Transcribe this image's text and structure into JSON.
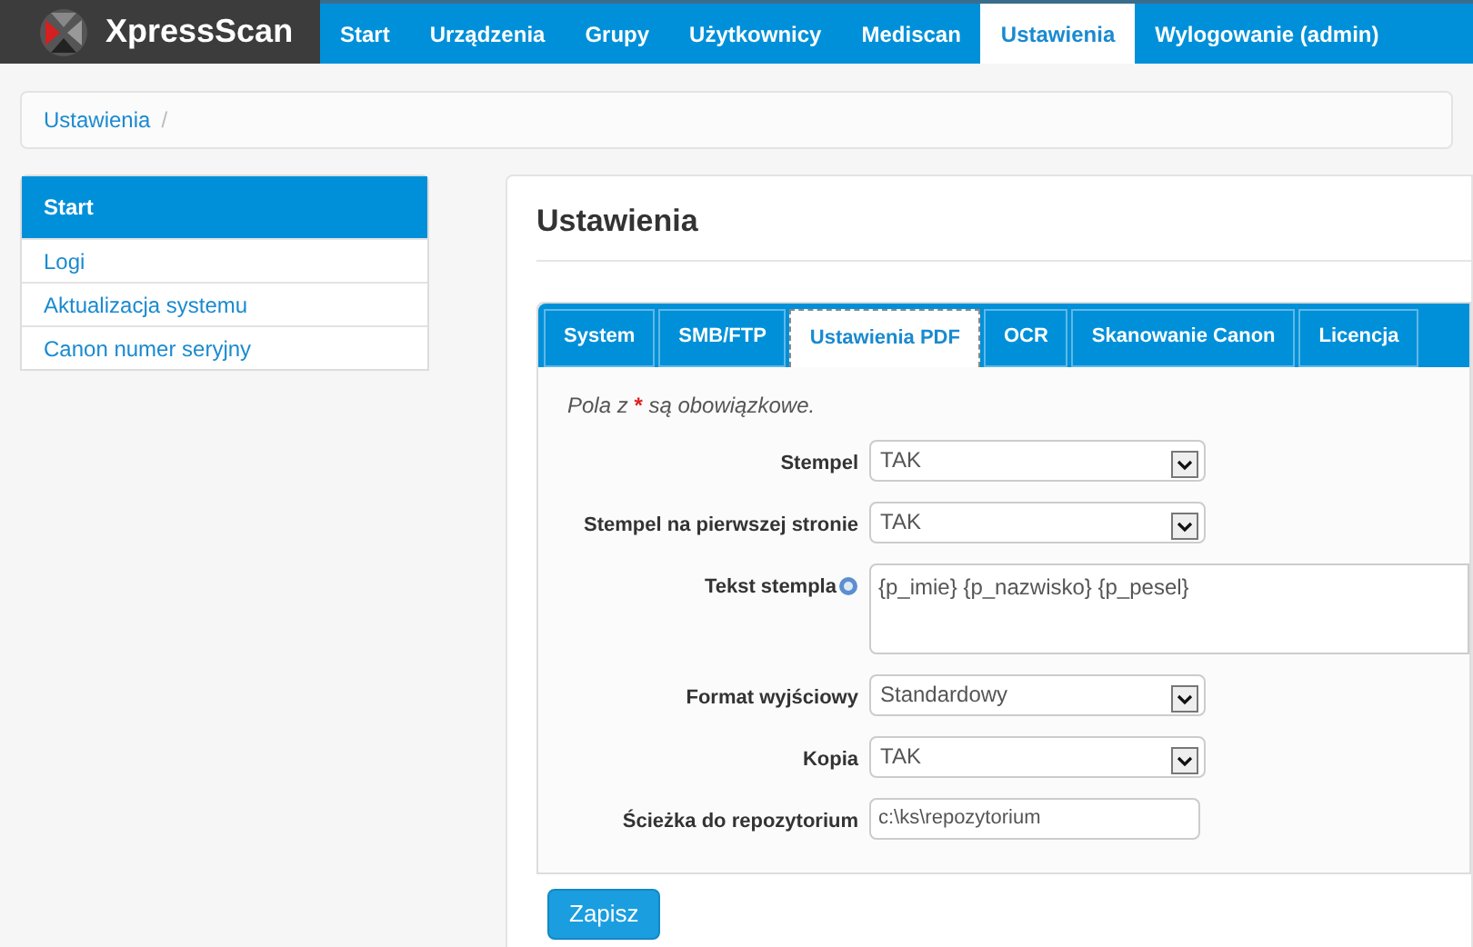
{
  "brand": {
    "name": "XpressScan"
  },
  "nav": [
    {
      "label": "Start",
      "selected": false
    },
    {
      "label": "Urządzenia",
      "selected": false
    },
    {
      "label": "Grupy",
      "selected": false
    },
    {
      "label": "Użytkownicy",
      "selected": false
    },
    {
      "label": "Mediscan",
      "selected": false
    },
    {
      "label": "Ustawienia",
      "selected": true
    },
    {
      "label": "Wylogowanie (admin)",
      "selected": false
    }
  ],
  "breadcrumb": [
    {
      "label": "Ustawienia",
      "separator": "/"
    }
  ],
  "sidebar": {
    "items": [
      {
        "label": "Start",
        "selected": true
      },
      {
        "label": "Logi",
        "selected": false
      },
      {
        "label": "Aktualizacja systemu",
        "selected": false
      },
      {
        "label": "Canon numer seryjny",
        "selected": false
      }
    ]
  },
  "page_title": "Ustawienia",
  "tabs": [
    {
      "label": "System",
      "selected": false
    },
    {
      "label": "SMB/FTP",
      "selected": false
    },
    {
      "label": "Ustawienia PDF",
      "selected": true
    },
    {
      "label": "OCR",
      "selected": false
    },
    {
      "label": "Skanowanie Canon",
      "selected": false
    },
    {
      "label": "Licencja",
      "selected": false
    }
  ],
  "required_note": {
    "prefix": "Pola z ",
    "mark": "*",
    "suffix": " są obowiązkowe."
  },
  "fields": [
    {
      "kind": "select",
      "label": "Stempel",
      "value": "TAK",
      "help": false
    },
    {
      "kind": "select",
      "label": "Stempel na pierwszej stronie",
      "value": "TAK",
      "help": false
    },
    {
      "kind": "textarea",
      "label": "Tekst stempla",
      "value": "{p_imie} {p_nazwisko} {p_pesel}",
      "help": true
    },
    {
      "kind": "select",
      "label": "Format wyjściowy",
      "value": "Standardowy",
      "help": false
    },
    {
      "kind": "select",
      "label": "Kopia",
      "value": "TAK",
      "help": false
    },
    {
      "kind": "text",
      "label": "Ścieżka do repozytorium",
      "value": "c:\\ks\\repozytorium",
      "help": false
    }
  ],
  "save_button": "Zapisz"
}
